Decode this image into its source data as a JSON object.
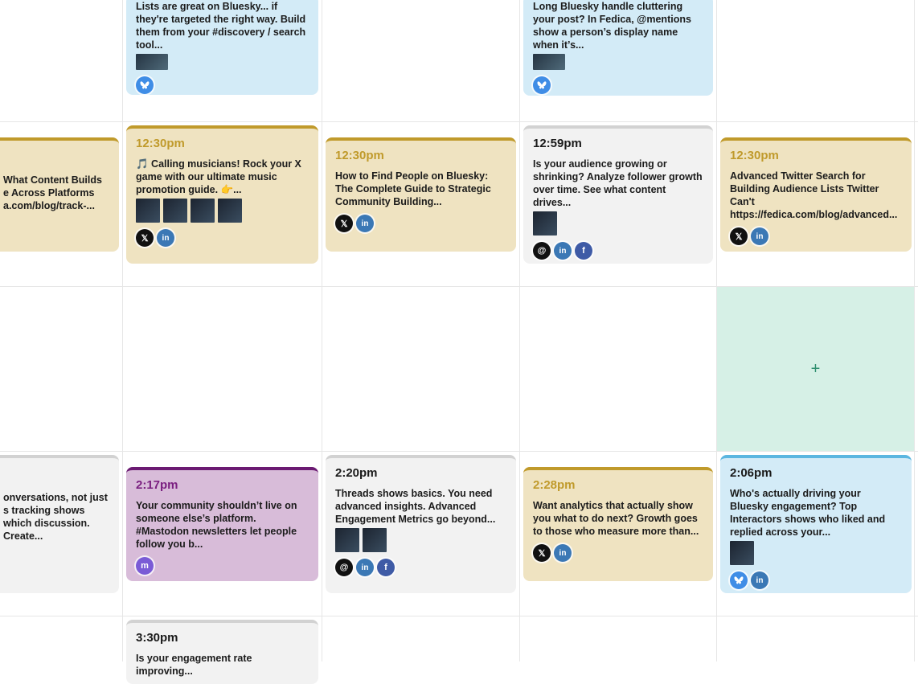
{
  "colors": {
    "blue_card": "#d3ebf7",
    "yellow_card": "#efe3c1",
    "gray_card": "#f2f2f2",
    "purple_card": "#d8bcd9",
    "add_cell": "#d6f0e6"
  },
  "cards": {
    "r0c1": {
      "text": "Lists are great on Bluesky... if they're targeted the right way. Build them from your #discovery / search tool..."
    },
    "r0c3": {
      "text": "Long Bluesky handle cluttering your post? In Fedica, @mentions show a person’s display name when it’s..."
    },
    "r1c0": {
      "text": "What Content Builds e Across Platforms a.com/blog/track-..."
    },
    "r1c1": {
      "time": "12:30pm",
      "text": "🎵 Calling musicians! Rock your X game with our ultimate music promotion guide. 👉..."
    },
    "r1c2": {
      "time": "12:30pm",
      "text": "How to Find People on Bluesky: The Complete Guide to Strategic Community Building..."
    },
    "r1c3": {
      "time": "12:59pm",
      "text": "Is your audience growing or shrinking? Analyze follower growth over time. See what content drives..."
    },
    "r1c4": {
      "time": "12:30pm",
      "text": "Advanced Twitter Search for Building Audience Lists Twitter Can't https://fedica.com/blog/advanced..."
    },
    "r3c0": {
      "text": "onversations, not just s tracking shows which discussion. Create..."
    },
    "r3c1": {
      "time": "2:17pm",
      "text": "Your community shouldn’t live on someone else’s platform. #Mastodon newsletters let people follow you b..."
    },
    "r3c2": {
      "time": "2:20pm",
      "text": "Threads shows basics. You need advanced insights. Advanced Engagement Metrics go beyond..."
    },
    "r3c3": {
      "time": "2:28pm",
      "text": "Want analytics that actually show you what to do next? Growth goes to those who measure more than..."
    },
    "r3c4": {
      "time": "2:06pm",
      "text": "Who's actually driving your Bluesky engagement? Top Interactors shows who liked and replied across your..."
    },
    "r4c1": {
      "time": "3:30pm",
      "text": "Is your engagement rate improving..."
    }
  },
  "icons": {
    "x": "x-icon",
    "linkedin": "in",
    "facebook": "f",
    "threads": "threads-icon",
    "bluesky": "bluesky-icon",
    "mastodon": "mastodon-icon"
  },
  "add_cell": {
    "label": "+"
  }
}
